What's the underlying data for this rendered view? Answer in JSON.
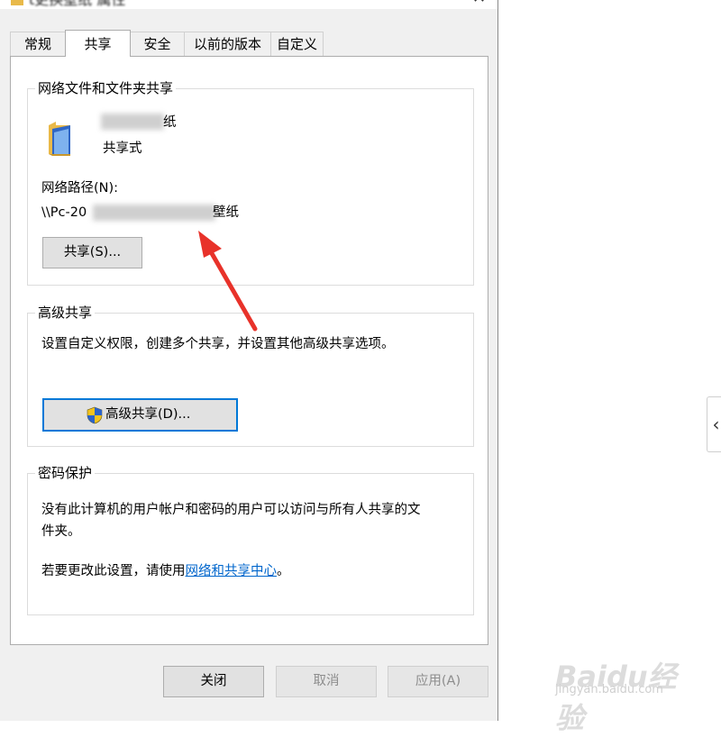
{
  "window": {
    "title": "t更换壁纸 属性"
  },
  "tabs": [
    {
      "label": "常规"
    },
    {
      "label": "共享"
    },
    {
      "label": "安全"
    },
    {
      "label": "以前的版本"
    },
    {
      "label": "自定义"
    }
  ],
  "network_sharing": {
    "group_title": "网络文件和文件夹共享",
    "folder_name": "纸",
    "share_state": "共享式",
    "path_label": "网络路径(N):",
    "path_prefix": "\\\\Pc-20",
    "path_suffix": "壁纸",
    "share_button": "共享(S)..."
  },
  "advanced_sharing": {
    "group_title": "高级共享",
    "description": "设置自定义权限，创建多个共享，并设置其他高级共享选项。",
    "button": "高级共享(D)..."
  },
  "password_protection": {
    "group_title": "密码保护",
    "description_line1": "没有此计算机的用户帐户和密码的用户可以访问与所有人共享的文",
    "description_line2": "件夹。",
    "change_prefix": "若要更改此设置，请使用",
    "change_link": "网络和共享中心",
    "change_suffix": "。"
  },
  "footer": {
    "close": "关闭",
    "cancel": "取消",
    "apply": "应用(A)"
  },
  "side_tab": {
    "glyph": "‹"
  },
  "watermark": {
    "logo": "Baidu经验",
    "sub": "jingyan.baidu.com"
  },
  "colors": {
    "arrow": "#e8322a",
    "link": "#0066cc",
    "button_focus_border": "#0078d7"
  },
  "icons": {
    "folder": "folder-icon",
    "shield": "uac-shield-icon"
  }
}
